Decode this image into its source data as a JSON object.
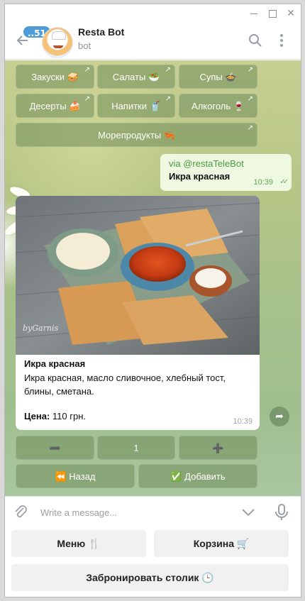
{
  "window": {
    "min_icon": "minimize-icon",
    "max_icon": "maximize-icon",
    "close_icon": "close-icon",
    "close_glyph": "✕"
  },
  "header": {
    "back_icon": "back-arrow-icon",
    "unread_badge": "..51",
    "title": "Resta Bot",
    "subtitle": "bot",
    "search_icon": "search-icon",
    "more_icon": "more-vertical-icon"
  },
  "inline_keyboard_top": {
    "rows": [
      [
        {
          "label": "Закуски 🥪"
        },
        {
          "label": "Салаты 🥗"
        },
        {
          "label": "Супы 🍲"
        }
      ],
      [
        {
          "label": "Десерты 🍰"
        },
        {
          "label": "Напитки 🥤"
        },
        {
          "label": "Алкоголь 🍷"
        }
      ],
      [
        {
          "label": "Морепродукты 🦐"
        }
      ]
    ],
    "share_arrow": "↗"
  },
  "outgoing_message": {
    "via": "via @restaTeleBot",
    "text": "Икра красная",
    "time": "10:39",
    "status_icon": "double-check-icon",
    "status_glyph": "✓✓"
  },
  "dish_card": {
    "photo_icon": "food-photo",
    "signature": "byGarnis",
    "title": "Икра красная",
    "description": "Икра красная, масло сливочное, хлебный тост, блины, сметана.",
    "price_label": "Цена:",
    "price_value": "110 грн.",
    "time": "10:39"
  },
  "share_button": {
    "icon": "share-icon",
    "glyph": "➦"
  },
  "inline_keyboard_bottom": {
    "minus": "➖",
    "quantity": "1",
    "plus": "➕",
    "back": "⏪ Назад",
    "add": "✅ Добавить"
  },
  "input_bar": {
    "attach_icon": "paperclip-icon",
    "placeholder": "Write a message...",
    "chevron_icon": "chevron-down-icon",
    "mic_icon": "microphone-icon"
  },
  "reply_keyboard": {
    "menu": "Меню 🍴",
    "cart": "Корзина 🛒",
    "reserve": "Забронировать столик 🕒"
  },
  "colors": {
    "accent": "#4e9bd8",
    "outgoing_bubble": "#eff8e1",
    "outgoing_text": "#4a9a43",
    "inline_button": "#708c5a"
  }
}
